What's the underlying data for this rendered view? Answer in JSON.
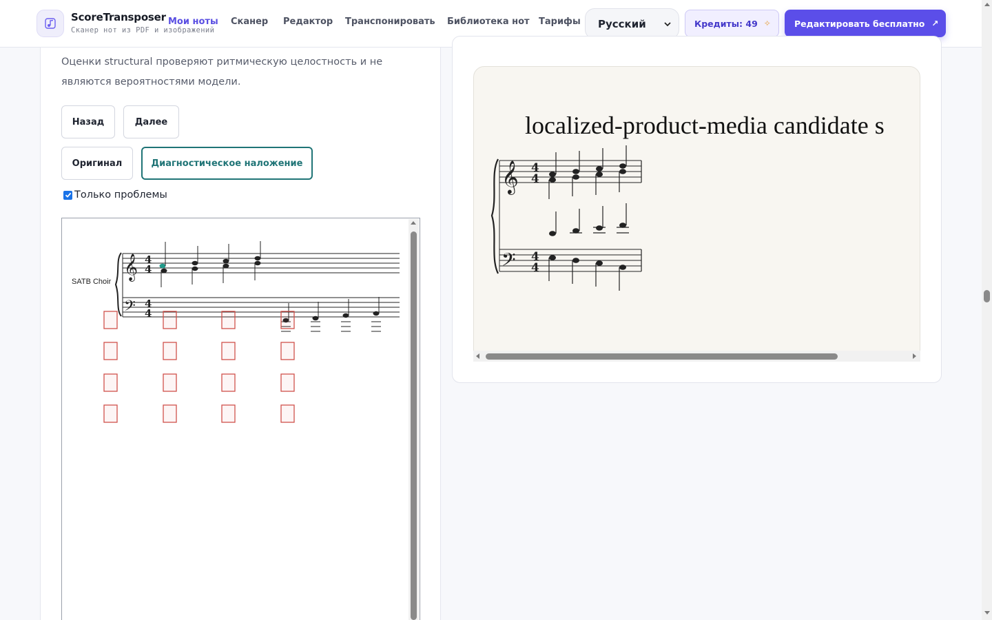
{
  "header": {
    "brand_name": "ScoreTransposer",
    "brand_tagline": "Сканер нот из PDF и изображений",
    "logo_icon": "music-note-icon",
    "nav": [
      {
        "label": "Мои ноты",
        "active": true
      },
      {
        "label": "Сканер",
        "active": false
      },
      {
        "label": "Редактор",
        "active": false
      },
      {
        "label": "Транспонировать",
        "active": false
      },
      {
        "label": "Библиотека нот",
        "active": false
      },
      {
        "label": "Тарифы",
        "active": false
      }
    ],
    "language": "Русский",
    "credits_label": "Кредиты: 49",
    "credits_icon": "sparkle-icon",
    "cta_label": "Редактировать бесплатно",
    "cta_icon": "external-arrow-icon",
    "accent_color": "#5b4ee9"
  },
  "left": {
    "description": "Оценки structural проверяют ритмическую целостность и не являются вероятностями модели.",
    "back_label": "Назад",
    "next_label": "Далее",
    "original_label": "Оригинал",
    "overlay_label": "Диагностическое наложение",
    "overlay_color": "#1f7476",
    "only_problems_label": "Только проблемы",
    "only_problems_checked": true,
    "score": {
      "part_name": "SATB Choir",
      "time_signature": "4/4",
      "problem_color": "#d9534f"
    }
  },
  "right": {
    "preview_title": "localized-product-media candidate s"
  }
}
